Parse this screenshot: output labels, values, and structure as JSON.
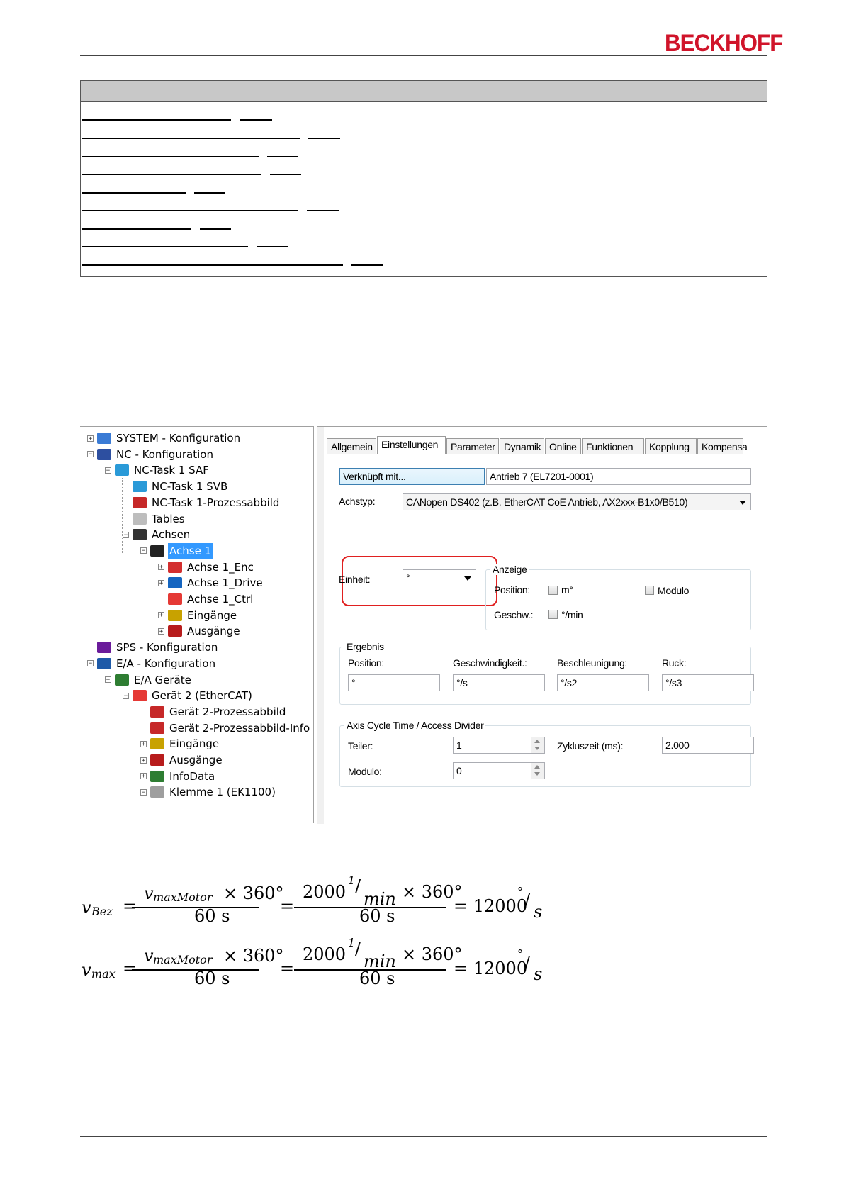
{
  "header": {
    "logo": "BECKHOFF"
  },
  "toc": {
    "entry_count": 9
  },
  "tree": {
    "nodes": [
      {
        "label": "SYSTEM - Konfiguration",
        "expander": "+",
        "icon": "system-config-icon"
      },
      {
        "label": "NC - Konfiguration",
        "expander": "-",
        "icon": "nc-config-icon"
      },
      {
        "label": "NC-Task 1 SAF",
        "expander": "-",
        "icon": "task-icon"
      },
      {
        "label": "NC-Task 1 SVB",
        "expander": "",
        "icon": "task-icon"
      },
      {
        "label": "NC-Task 1-Prozessabbild",
        "expander": "",
        "icon": "process-image-icon"
      },
      {
        "label": "Tables",
        "expander": "",
        "icon": "table-icon"
      },
      {
        "label": "Achsen",
        "expander": "-",
        "icon": "axes-icon"
      },
      {
        "label": "Achse 1",
        "expander": "-",
        "icon": "axis-icon",
        "selected": true
      },
      {
        "label": "Achse 1_Enc",
        "expander": "+",
        "icon": "encoder-icon"
      },
      {
        "label": "Achse 1_Drive",
        "expander": "+",
        "icon": "drive-icon"
      },
      {
        "label": "Achse 1_Ctrl",
        "expander": "",
        "icon": "controller-icon"
      },
      {
        "label": "Eingänge",
        "expander": "+",
        "icon": "inputs-icon"
      },
      {
        "label": "Ausgänge",
        "expander": "+",
        "icon": "outputs-icon"
      },
      {
        "label": "SPS - Konfiguration",
        "expander": "",
        "icon": "plc-config-icon"
      },
      {
        "label": "E/A - Konfiguration",
        "expander": "-",
        "icon": "io-config-icon"
      },
      {
        "label": "E/A Geräte",
        "expander": "-",
        "icon": "io-devices-icon"
      },
      {
        "label": "Gerät 2 (EtherCAT)",
        "expander": "-",
        "icon": "ethercat-device-icon"
      },
      {
        "label": "Gerät 2-Prozessabbild",
        "expander": "",
        "icon": "process-image-icon"
      },
      {
        "label": "Gerät 2-Prozessabbild-Info",
        "expander": "",
        "icon": "process-image-icon"
      },
      {
        "label": "Eingänge",
        "expander": "+",
        "icon": "inputs-icon"
      },
      {
        "label": "Ausgänge",
        "expander": "+",
        "icon": "outputs-icon"
      },
      {
        "label": "InfoData",
        "expander": "+",
        "icon": "infodata-icon"
      },
      {
        "label": "Klemme 1 (EK1100)",
        "expander": "-",
        "icon": "terminal-icon"
      }
    ]
  },
  "tabs": [
    "Allgemein",
    "Einstellungen",
    "Parameter",
    "Dynamik",
    "Online",
    "Funktionen",
    "Kopplung",
    "Kompensa"
  ],
  "settings": {
    "link_button": "Verknüpft mit...",
    "link_value": "Antrieb 7 (EL7201-0001)",
    "axis_type_label": "Achstyp:",
    "axis_type_value": "CANopen DS402  (z.B. EtherCAT CoE Antrieb, AX2xxx-B1x0/B510)",
    "unit_label": "Einheit:",
    "unit_value": "°",
    "display_group": "Anzeige",
    "position_label": "Position:",
    "position_unit": "m°",
    "modulo_check_label": "Modulo",
    "speed_label": "Geschw.:",
    "speed_unit": "°/min",
    "result_group": "Ergebnis",
    "res_position_label": "Position:",
    "res_position_value": "°",
    "res_velocity_label": "Geschwindigkeit.:",
    "res_velocity_value": "°/s",
    "res_accel_label": "Beschleunigung:",
    "res_accel_value": "°/s2",
    "res_jerk_label": "Ruck:",
    "res_jerk_value": "°/s3",
    "cycle_group": "Axis Cycle Time / Access Divider",
    "divider_label": "Teiler:",
    "divider_value": "1",
    "cycle_label": "Zykluszeit (ms):",
    "cycle_value": "2.000",
    "modulo_label": "Modulo:",
    "modulo_value": "0"
  },
  "formulas": [
    {
      "lhs": "v",
      "lhs_sub": "Bez",
      "num1": "v",
      "num1_sub": "maxMotor",
      "times": "× 360°",
      "den": "60 s",
      "num2_a": "2000",
      "num2_unit_num": "1",
      "num2_unit_den": "min",
      "num2_b": "× 360°",
      "result": "= 12000",
      "result_unit_num": "°",
      "result_unit_den": "s"
    },
    {
      "lhs": "v",
      "lhs_sub": "max",
      "num1": "v",
      "num1_sub": "maxMotor",
      "times": "× 360°",
      "den": "60 s",
      "num2_a": "2000",
      "num2_unit_num": "1",
      "num2_unit_den": "min",
      "num2_b": "× 360°",
      "result": "= 12000",
      "result_unit_num": "°",
      "result_unit_den": "s"
    }
  ],
  "colors": {
    "brand": "#d0142a",
    "selection": "#3399ff",
    "highlight": "#e02020"
  }
}
